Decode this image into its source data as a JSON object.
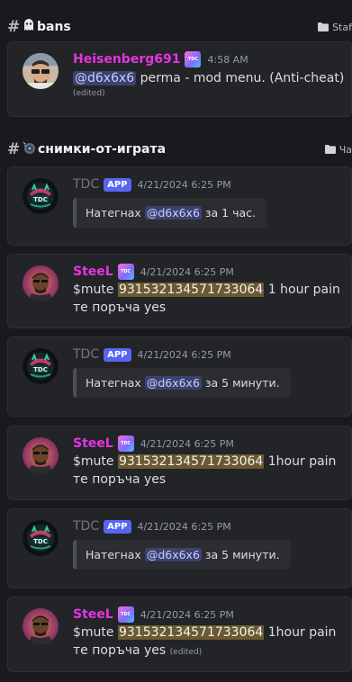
{
  "channel1": {
    "hash": "#",
    "name": "bans",
    "category": "Staf"
  },
  "channel2": {
    "hash": "#",
    "name": "снимки-от-играта",
    "category": "Ча"
  },
  "messages": [
    {
      "author": "Heisenberg691",
      "time": "4:58 AM",
      "mention": "@d6x6x6",
      "text": " perma - mod menu. (Anti-cheat)",
      "edited": "(edited)"
    },
    {
      "author": "TDC",
      "badge": "APP",
      "time": "4/21/2024 6:25 PM",
      "embed_pre": "Натегнах ",
      "embed_mention": "@d6x6x6",
      "embed_post": " за 1 час."
    },
    {
      "author": "SteeL",
      "time": "4/21/2024 6:25 PM",
      "pre": "$mute ",
      "id": "931532134571733064",
      "post": " 1 hour  pain те поръча yes"
    },
    {
      "author": "TDC",
      "badge": "APP",
      "time": "4/21/2024 6:25 PM",
      "embed_pre": "Натегнах ",
      "embed_mention": "@d6x6x6",
      "embed_post": " за 5 минути."
    },
    {
      "author": "SteeL",
      "time": "4/21/2024 6:25 PM",
      "pre": "$mute ",
      "id": "931532134571733064",
      "post": " 1hour  pain те поръча yes"
    },
    {
      "author": "TDC",
      "badge": "APP",
      "time": "4/21/2024 6:25 PM",
      "embed_pre": "Натегнах ",
      "embed_mention": "@d6x6x6",
      "embed_post": " за 5 минути."
    },
    {
      "author": "SteeL",
      "time": "4/21/2024 6:25 PM",
      "pre": "$mute ",
      "id": "931532134571733064",
      "post": " 1hour  pain те поръча yes",
      "edited": "(edited)"
    }
  ],
  "badges": {
    "role_badge_text": "TDC"
  },
  "colors": {
    "accent": "#5865f2",
    "author_pink": "#e434e2",
    "background": "#1a1a1e",
    "card": "#232428"
  }
}
